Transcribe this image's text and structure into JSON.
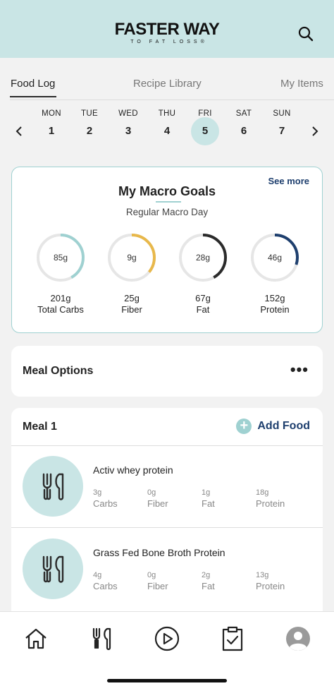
{
  "header": {
    "logo_main": "FASTER WAY",
    "logo_sub": "TO FAT LOSS®",
    "search_icon": "search-icon"
  },
  "tabs": [
    {
      "label": "Food Log",
      "active": true
    },
    {
      "label": "Recipe Library",
      "active": false
    },
    {
      "label": "My Items",
      "active": false
    }
  ],
  "week": {
    "days": [
      {
        "name": "MON",
        "num": "1"
      },
      {
        "name": "TUE",
        "num": "2"
      },
      {
        "name": "WED",
        "num": "3"
      },
      {
        "name": "THU",
        "num": "4"
      },
      {
        "name": "FRI",
        "num": "5",
        "active": true
      },
      {
        "name": "SAT",
        "num": "6"
      },
      {
        "name": "SUN",
        "num": "7"
      }
    ]
  },
  "macros": {
    "title": "My Macro Goals",
    "subtitle": "Regular Macro Day",
    "see_more": "See more",
    "items": [
      {
        "value": "85g",
        "total": "201g",
        "name": "Total Carbs",
        "fraction": 0.42,
        "color": "#9fd1d1"
      },
      {
        "value": "9g",
        "total": "25g",
        "name": "Fiber",
        "fraction": 0.36,
        "color": "#e8b84b"
      },
      {
        "value": "28g",
        "total": "67g",
        "name": "Fat",
        "fraction": 0.42,
        "color": "#2b2b2b"
      },
      {
        "value": "46g",
        "total": "152g",
        "name": "Protein",
        "fraction": 0.3,
        "color": "#1e3f6e"
      }
    ]
  },
  "meal_options": {
    "label": "Meal Options",
    "more": "•••"
  },
  "meal": {
    "label": "Meal 1",
    "add_label": "Add Food",
    "foods": [
      {
        "name": "Activ whey protein",
        "nutrients": [
          {
            "value": "3g",
            "label": "Carbs"
          },
          {
            "value": "0g",
            "label": "Fiber"
          },
          {
            "value": "1g",
            "label": "Fat"
          },
          {
            "value": "18g",
            "label": "Protein"
          }
        ]
      },
      {
        "name": "Grass Fed Bone Broth Protein",
        "nutrients": [
          {
            "value": "4g",
            "label": "Carbs"
          },
          {
            "value": "0g",
            "label": "Fiber"
          },
          {
            "value": "2g",
            "label": "Fat"
          },
          {
            "value": "13g",
            "label": "Protein"
          }
        ]
      }
    ]
  },
  "colors": {
    "accent": "#9fd1d1",
    "header_bg": "#c9e5e5",
    "link": "#1e3f6e"
  },
  "nav": [
    "home-icon",
    "fork-knife-icon",
    "play-icon",
    "clipboard-check-icon",
    "profile-icon"
  ]
}
